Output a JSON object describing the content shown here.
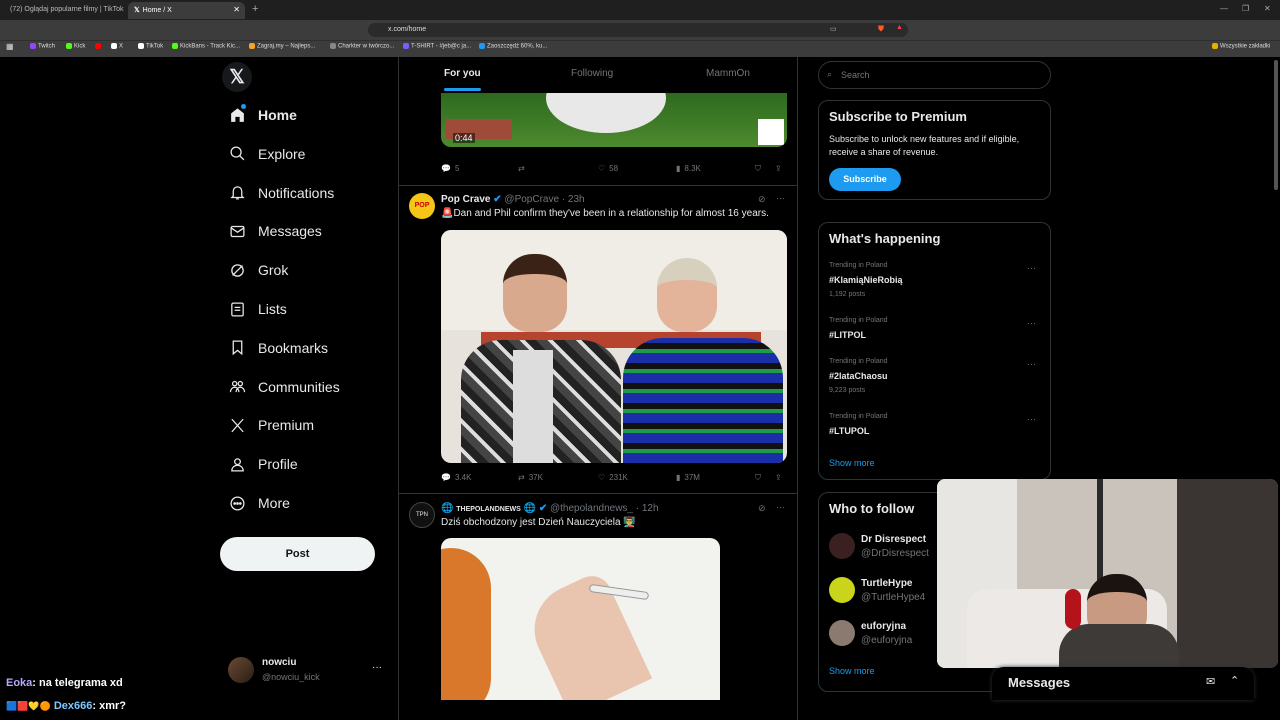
{
  "browser": {
    "tabs": [
      {
        "title": "(72) Oglądaj popularne filmy | TikTok"
      },
      {
        "title": "Home / X",
        "active": true
      }
    ],
    "url": "x.com/home",
    "bookmarks": [
      {
        "label": "Twitch",
        "color": "#9146ff"
      },
      {
        "label": "Kick",
        "color": "#53fc18"
      },
      {
        "label": "",
        "color": "#ff0000"
      },
      {
        "label": "X",
        "color": "#ffffff"
      },
      {
        "label": "TikTok",
        "color": "#ffffff"
      },
      {
        "label": "KickBans - Track Kic...",
        "color": "#53fc18"
      },
      {
        "label": "Zagraj.my – Najleps...",
        "color": "#f5a623"
      },
      {
        "label": "Charkter w twórczo...",
        "color": "#888888"
      },
      {
        "label": "T-SHIRT - #jeb@c ja...",
        "color": "#7b5cff"
      },
      {
        "label": "Zaoszczędź 60%, ku...",
        "color": "#1d9bf0"
      }
    ],
    "all_bookmarks": "Wszystkie zakładki"
  },
  "nav": {
    "items": [
      {
        "label": "Home",
        "icon": "home-icon"
      },
      {
        "label": "Explore",
        "icon": "search-icon"
      },
      {
        "label": "Notifications",
        "icon": "bell-icon"
      },
      {
        "label": "Messages",
        "icon": "mail-icon"
      },
      {
        "label": "Grok",
        "icon": "grok-icon"
      },
      {
        "label": "Lists",
        "icon": "list-icon"
      },
      {
        "label": "Bookmarks",
        "icon": "bookmark-icon"
      },
      {
        "label": "Communities",
        "icon": "communities-icon"
      },
      {
        "label": "Premium",
        "icon": "x-logo-icon"
      },
      {
        "label": "Profile",
        "icon": "person-icon"
      },
      {
        "label": "More",
        "icon": "more-circle-icon"
      }
    ],
    "post": "Post",
    "account": {
      "name": "nowciu",
      "handle": "@nowciu_kick"
    }
  },
  "feed": {
    "tabs": [
      "For you",
      "Following",
      "MammOn"
    ],
    "tweet0": {
      "video_time": "0:44",
      "replies": "5",
      "reposts": "",
      "likes": "58",
      "views": "8.3K"
    },
    "tweet1": {
      "name": "Pop Crave",
      "handle": "@PopCrave",
      "time": "· 23h",
      "text": "Dan and Phil confirm they've been in a relationship for almost 16 years.",
      "replies": "3.4K",
      "reposts": "37K",
      "likes": "231K",
      "views": "37M"
    },
    "tweet2": {
      "name": "THEPOLANDNEWS",
      "handle": "@thepolandnews_",
      "time": "· 12h",
      "text": "Dziś obchodzony jest Dzień Nauczyciela 👨‍🏫"
    }
  },
  "right": {
    "search_placeholder": "Search",
    "premium": {
      "title": "Subscribe to Premium",
      "body": "Subscribe to unlock new features and if eligible, receive a share of revenue.",
      "button": "Subscribe"
    },
    "happening": {
      "title": "What's happening",
      "trends": [
        {
          "context": "Trending in Poland",
          "tag": "#KlamiąNieRobią",
          "posts": "1,192 posts"
        },
        {
          "context": "Trending in Poland",
          "tag": "#LITPOL",
          "posts": ""
        },
        {
          "context": "Trending in Poland",
          "tag": "#2lataChaosu",
          "posts": "9,223 posts"
        },
        {
          "context": "Trending in Poland",
          "tag": "#LTUPOL",
          "posts": ""
        }
      ],
      "show_more": "Show more"
    },
    "follow": {
      "title": "Who to follow",
      "users": [
        {
          "name": "Dr Disrespect",
          "handle": "@DrDisrespect"
        },
        {
          "name": "TurtleHype",
          "handle": "@TurtleHype4"
        },
        {
          "name": "euforyjna",
          "handle": "@euforyjna"
        }
      ],
      "show_more": "Show more"
    }
  },
  "messages": {
    "title": "Messages"
  },
  "stream_chat": [
    {
      "user": "Eoka",
      "text": ": na telegrama  xd",
      "color": "#b9a7ff"
    },
    {
      "user": "Dex666",
      "text": ": xmr?",
      "color": "#7ec8ff"
    }
  ]
}
